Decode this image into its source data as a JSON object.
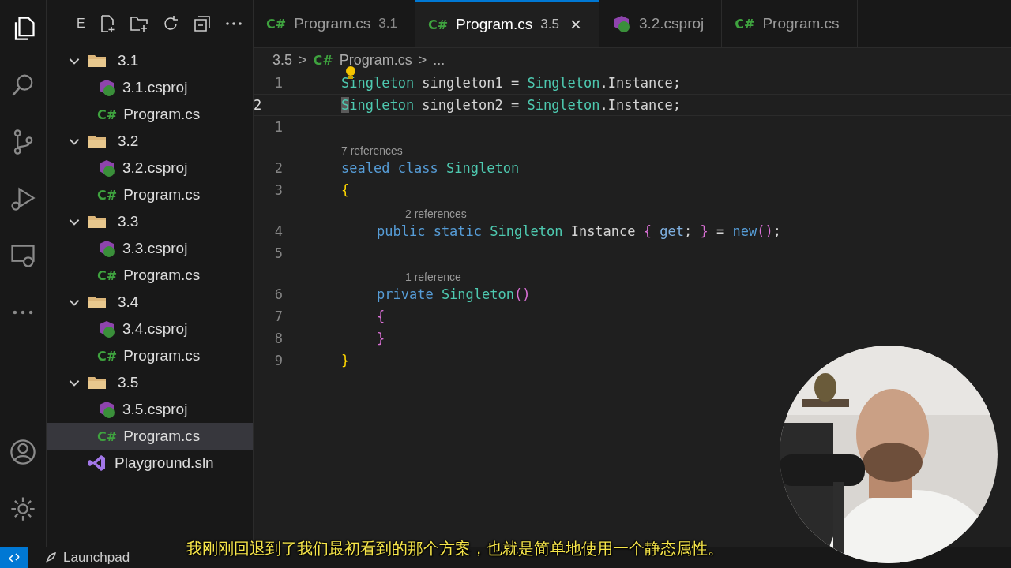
{
  "explorer": {
    "title": "E",
    "items": [
      {
        "kind": "folder",
        "label": "3.1",
        "expanded": true,
        "selected": false,
        "children": [
          {
            "kind": "csproj",
            "label": "3.1.csproj",
            "selected": false
          },
          {
            "kind": "cs",
            "icon_text": "C#",
            "label": "Program.cs",
            "selected": false
          }
        ]
      },
      {
        "kind": "folder",
        "label": "3.2",
        "expanded": true,
        "selected": false,
        "children": [
          {
            "kind": "csproj",
            "label": "3.2.csproj",
            "selected": false
          },
          {
            "kind": "cs",
            "icon_text": "C#",
            "label": "Program.cs",
            "selected": false
          }
        ]
      },
      {
        "kind": "folder",
        "label": "3.3",
        "expanded": true,
        "selected": false,
        "children": [
          {
            "kind": "csproj",
            "label": "3.3.csproj",
            "selected": false
          },
          {
            "kind": "cs",
            "icon_text": "C#",
            "label": "Program.cs",
            "selected": false
          }
        ]
      },
      {
        "kind": "folder",
        "label": "3.4",
        "expanded": true,
        "selected": false,
        "children": [
          {
            "kind": "csproj",
            "label": "3.4.csproj",
            "selected": false
          },
          {
            "kind": "cs",
            "icon_text": "C#",
            "label": "Program.cs",
            "selected": false
          }
        ]
      },
      {
        "kind": "folder",
        "label": "3.5",
        "expanded": true,
        "selected": false,
        "children": [
          {
            "kind": "csproj",
            "label": "3.5.csproj",
            "selected": false
          },
          {
            "kind": "cs",
            "icon_text": "C#",
            "label": "Program.cs",
            "selected": true
          }
        ]
      },
      {
        "kind": "sln",
        "label": "Playground.sln",
        "selected": false
      }
    ]
  },
  "tabs": [
    {
      "kind": "cs",
      "icon_text": "C#",
      "label": "Program.cs",
      "detail": "3.1",
      "selected": false
    },
    {
      "kind": "cs",
      "icon_text": "C#",
      "label": "Program.cs",
      "detail": "3.5",
      "selected": true,
      "close": "×"
    },
    {
      "kind": "csproj",
      "label": "3.2.csproj",
      "selected": false
    },
    {
      "kind": "cs",
      "icon_text": "C#",
      "label": "Program.cs",
      "selected": false
    }
  ],
  "breadcrumbs": {
    "folder": "3.5",
    "separator": ">",
    "icon_text": "C#",
    "file": "Program.cs",
    "more": "..."
  },
  "editor": {
    "lines": [
      {
        "kind": "code",
        "number": "1",
        "current": false,
        "bulb": true,
        "tokens": [
          {
            "kind": "type",
            "text": "Singleton"
          },
          {
            "kind": "plain",
            "text": " singleton1 = "
          },
          {
            "kind": "type",
            "text": "Singleton"
          },
          {
            "kind": "plain",
            "text": ".Instance;"
          }
        ]
      },
      {
        "kind": "code",
        "number": "2",
        "current": true,
        "tokens": [
          {
            "kind": "type",
            "text": "Singleton"
          },
          {
            "kind": "plain",
            "text": " singleton2 = "
          },
          {
            "kind": "type",
            "text": "Singleton"
          },
          {
            "kind": "plain",
            "text": ".Instance;"
          }
        ]
      },
      {
        "kind": "code",
        "number": "1",
        "current": false
      },
      {
        "kind": "lens",
        "text": "7 references"
      },
      {
        "kind": "code",
        "number": "2",
        "current": false,
        "tokens": [
          {
            "kind": "keyword",
            "text": "sealed class "
          },
          {
            "kind": "type",
            "text": "Singleton"
          }
        ]
      },
      {
        "kind": "code",
        "number": "3",
        "current": false,
        "tokens": [
          {
            "kind": "brace1",
            "text": "{"
          }
        ]
      },
      {
        "kind": "lens",
        "text": "2 references",
        "indented": true
      },
      {
        "kind": "code",
        "number": "4",
        "current": false,
        "indented": true,
        "tokens": [
          {
            "kind": "keyword",
            "text": "public static "
          },
          {
            "kind": "type",
            "text": "Singleton"
          },
          {
            "kind": "plain",
            "text": " Instance "
          },
          {
            "kind": "brace2",
            "text": "{"
          },
          {
            "kind": "accessor",
            "text": " get"
          },
          {
            "kind": "plain",
            "text": "; "
          },
          {
            "kind": "brace2",
            "text": "}"
          },
          {
            "kind": "plain",
            "text": " = "
          },
          {
            "kind": "keyword",
            "text": "new"
          },
          {
            "kind": "brace2",
            "text": "()"
          },
          {
            "kind": "plain",
            "text": ";"
          }
        ]
      },
      {
        "kind": "code",
        "number": "5",
        "current": false
      },
      {
        "kind": "lens",
        "text": "1 reference",
        "indented": true
      },
      {
        "kind": "code",
        "number": "6",
        "current": false,
        "indented": true,
        "tokens": [
          {
            "kind": "keyword",
            "text": "private "
          },
          {
            "kind": "type",
            "text": "Singleton"
          },
          {
            "kind": "brace2",
            "text": "()"
          }
        ]
      },
      {
        "kind": "code",
        "number": "7",
        "current": false,
        "indented": true,
        "tokens": [
          {
            "kind": "brace2",
            "text": "{"
          }
        ]
      },
      {
        "kind": "code",
        "number": "8",
        "current": false,
        "indented": true,
        "tokens": [
          {
            "kind": "brace2",
            "text": "}"
          }
        ]
      },
      {
        "kind": "code",
        "number": "9",
        "current": false,
        "tokens": [
          {
            "kind": "brace1",
            "text": "}"
          }
        ]
      }
    ]
  },
  "status_bar": {
    "items": [
      {
        "kind": "launchpad",
        "label": "Launchpad"
      }
    ]
  },
  "video_overlay": {
    "kind": "picture",
    "subtitle": "我刚刚回退到了我们最初看到的那个方案，也就是简单地使用一个静态属性。"
  }
}
